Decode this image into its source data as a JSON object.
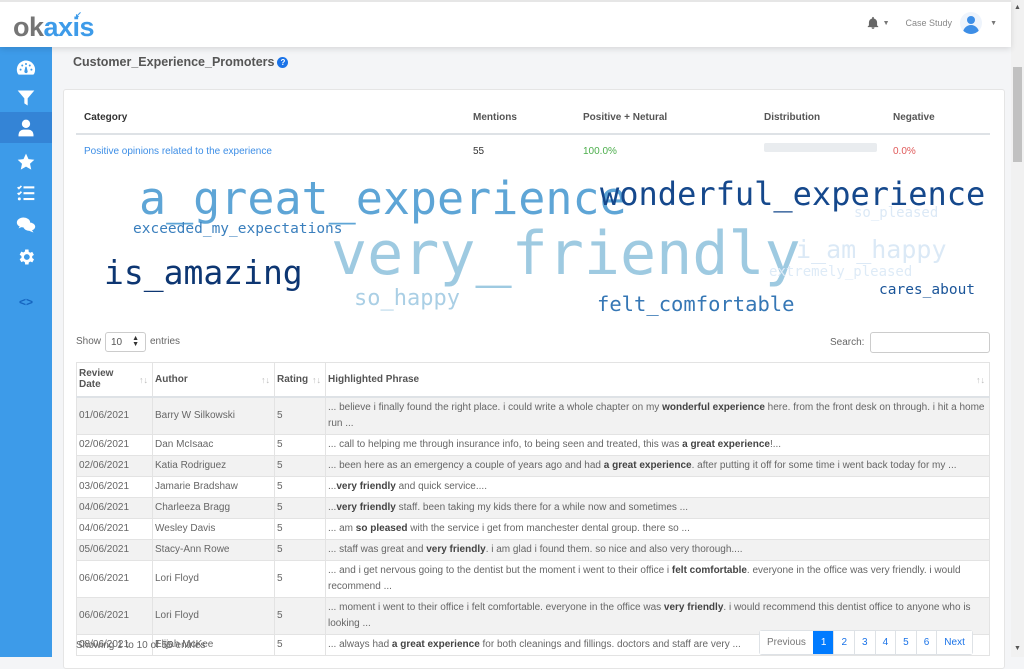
{
  "app": {
    "logo_ok": "ok",
    "logo_axis": "axis",
    "user_label": "Case Study"
  },
  "page": {
    "title": "Customer_Experience_Promoters",
    "help": "?"
  },
  "summary": {
    "headers": {
      "category": "Category",
      "mentions": "Mentions",
      "positive": "Positive + Netural",
      "distribution": "Distribution",
      "negative": "Negative"
    },
    "row": {
      "category": "Positive opinions related to the experience",
      "mentions": "55",
      "positive": "100.0%",
      "distribution_positive_fraction": 1.0,
      "negative": "0.0%"
    },
    "colors": {
      "positive": "#4cae4c",
      "negative": "#e05a5a",
      "bar": "#28a745"
    }
  },
  "word_cloud": [
    {
      "text": "a_great_experience",
      "weight": "large",
      "color": "#5ea5d6"
    },
    {
      "text": "wonderful_experience",
      "weight": "large",
      "color": "#15488c"
    },
    {
      "text": "so_pleased",
      "weight": "small",
      "color": "#dce9f6"
    },
    {
      "text": "exceeded_my_expectations",
      "weight": "small",
      "color": "#3a7fbd"
    },
    {
      "text": "very_friendly",
      "weight": "largest",
      "color": "#9ecae1"
    },
    {
      "text": "i_am_happy",
      "weight": "medium",
      "color": "#dbe9f6"
    },
    {
      "text": "is_amazing",
      "weight": "medium",
      "color": "#0d3672"
    },
    {
      "text": "extremely_pleased",
      "weight": "small",
      "color": "#deebf7"
    },
    {
      "text": "so_happy",
      "weight": "medium",
      "color": "#aacfe5"
    },
    {
      "text": "felt_comfortable",
      "weight": "medium",
      "color": "#3677b5"
    },
    {
      "text": "cares_about",
      "weight": "small",
      "color": "#1b5599"
    }
  ],
  "table_controls": {
    "show": "Show",
    "length": "10",
    "entries": "entries",
    "search_label": "Search:",
    "search_value": ""
  },
  "table": {
    "columns": [
      "Review Date",
      "Author",
      "Rating",
      "Highlighted Phrase"
    ],
    "rows": [
      {
        "date": "01/06/2021",
        "author": "Barry W Silkowski",
        "rating": "5",
        "pre": "... believe i finally found the right place. i could write a whole chapter on my ",
        "bold": "wonderful experience",
        "post": " here. from the front desk on through. i hit a home run ..."
      },
      {
        "date": "02/06/2021",
        "author": "Dan McIsaac",
        "rating": "5",
        "pre": "... call to helping me through insurance info, to being seen and treated, this was ",
        "bold": "a great experience",
        "post": "!..."
      },
      {
        "date": "02/06/2021",
        "author": "Katia Rodriguez",
        "rating": "5",
        "pre": "... been here as an emergency a couple of years ago and had ",
        "bold": "a great experience",
        "post": ". after putting it off for some time i went back today for my ..."
      },
      {
        "date": "03/06/2021",
        "author": "Jamarie Bradshaw",
        "rating": "5",
        "pre": "...",
        "bold": "very friendly",
        "post": " and quick service...."
      },
      {
        "date": "04/06/2021",
        "author": "Charleeza Bragg",
        "rating": "5",
        "pre": "...",
        "bold": "very friendly",
        "post": " staff. been taking my kids there for a while now and sometimes ..."
      },
      {
        "date": "04/06/2021",
        "author": "Wesley Davis",
        "rating": "5",
        "pre": "... am ",
        "bold": "so pleased",
        "post": " with the service i get from manchester dental group. there so ..."
      },
      {
        "date": "05/06/2021",
        "author": "Stacy-Ann Rowe",
        "rating": "5",
        "pre": "... staff was great and ",
        "bold": "very friendly",
        "post": ". i am glad i found them. so nice and also very thorough...."
      },
      {
        "date": "06/06/2021",
        "author": "Lori Floyd",
        "rating": "5",
        "pre": "... and i get nervous going to the dentist but the moment i went to their office i ",
        "bold": "felt comfortable",
        "post": ". everyone in the office was very friendly. i would recommend ..."
      },
      {
        "date": "06/06/2021",
        "author": "Lori Floyd",
        "rating": "5",
        "pre": "... moment i went to their office i felt comfortable. everyone in the office was ",
        "bold": "very friendly",
        "post": ". i would recommend this dentist office to anyone who is looking ..."
      },
      {
        "date": "08/06/2021",
        "author": "Elijah McKee",
        "rating": "5",
        "pre": "... always had ",
        "bold": "a great experience",
        "post": " for both cleanings and fillings. doctors and staff are very ..."
      }
    ]
  },
  "footer": {
    "info": "Showing 1 to 10 of 55 entries",
    "pager": [
      "Previous",
      "1",
      "2",
      "3",
      "4",
      "5",
      "6",
      "Next"
    ],
    "active_page": "1"
  }
}
